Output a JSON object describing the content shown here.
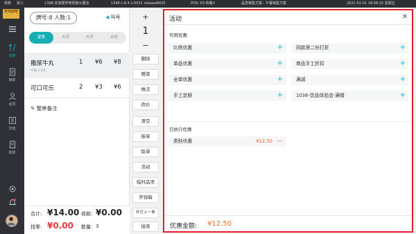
{
  "topbar": {
    "role": "收款",
    "user": "张三",
    "store": "1398-支收银学苑凯德大厦店",
    "version": "1398-c.8.4.1.6631 release8420",
    "pos": "POS: 03-快餐3",
    "plan": "品尝销售方案：午餐销售方案",
    "datetime": "2021-01-01 18:56:23 星期五"
  },
  "logo": "天天好吃",
  "sidebar": {
    "items": [
      {
        "label": "点菜",
        "icon": "fork-knife-icon"
      },
      {
        "label": "接单",
        "icon": "receipt-icon"
      },
      {
        "label": "会员",
        "icon": "member-icon"
      },
      {
        "label": "交班",
        "icon": "shift-icon"
      },
      {
        "label": "账单",
        "icon": "bill-icon"
      }
    ]
  },
  "order": {
    "table_label": "牌号:8  人数:1",
    "call_label": "叫号",
    "tabs": [
      "堂食",
      "外带",
      "外卖",
      "自提"
    ],
    "items": [
      {
        "name": "撒尿牛丸",
        "qty": "1",
        "price": "¥6",
        "total": "¥8",
        "sub": "牛筋-2.0元"
      },
      {
        "name": "可口可乐",
        "qty": "2",
        "price": "¥3",
        "total": "¥6"
      }
    ],
    "remark": "整单备注",
    "footer": {
      "total_label": "合计:",
      "total_value": "¥14.00",
      "received_label": "收款:",
      "received_value": "¥0.00",
      "change_label": "找零:",
      "change_value": "¥0.00",
      "count_label": "数量:",
      "count_value": "3"
    }
  },
  "mid": {
    "plus": "+",
    "qty": "1",
    "minus": "−",
    "buttons": [
      "删除",
      "赠菜",
      "做法",
      "改价",
      "清空",
      "挂单",
      "取单",
      "活动",
      "临时品项",
      "开钱箱",
      "补打上一单",
      "接菜"
    ]
  },
  "activity": {
    "title": "活动",
    "available_label": "可用优惠",
    "options": [
      "比例优惠",
      "同款第二份打折",
      "单品优惠",
      "商品手工折扣",
      "全单优惠",
      "满减",
      "手工定额",
      "1036-饮品体验店-满赠"
    ],
    "applied_label": "已执行优惠",
    "applied": [
      {
        "name": "类别优惠",
        "amount": "¥12.50"
      }
    ],
    "sum_label": "优惠金额:",
    "sum_value": "¥12.50"
  },
  "colors": {
    "accent": "#17aeb5",
    "highlight_border": "#e41e26",
    "price_orange": "#e86c2c",
    "red": "#e8383d"
  }
}
